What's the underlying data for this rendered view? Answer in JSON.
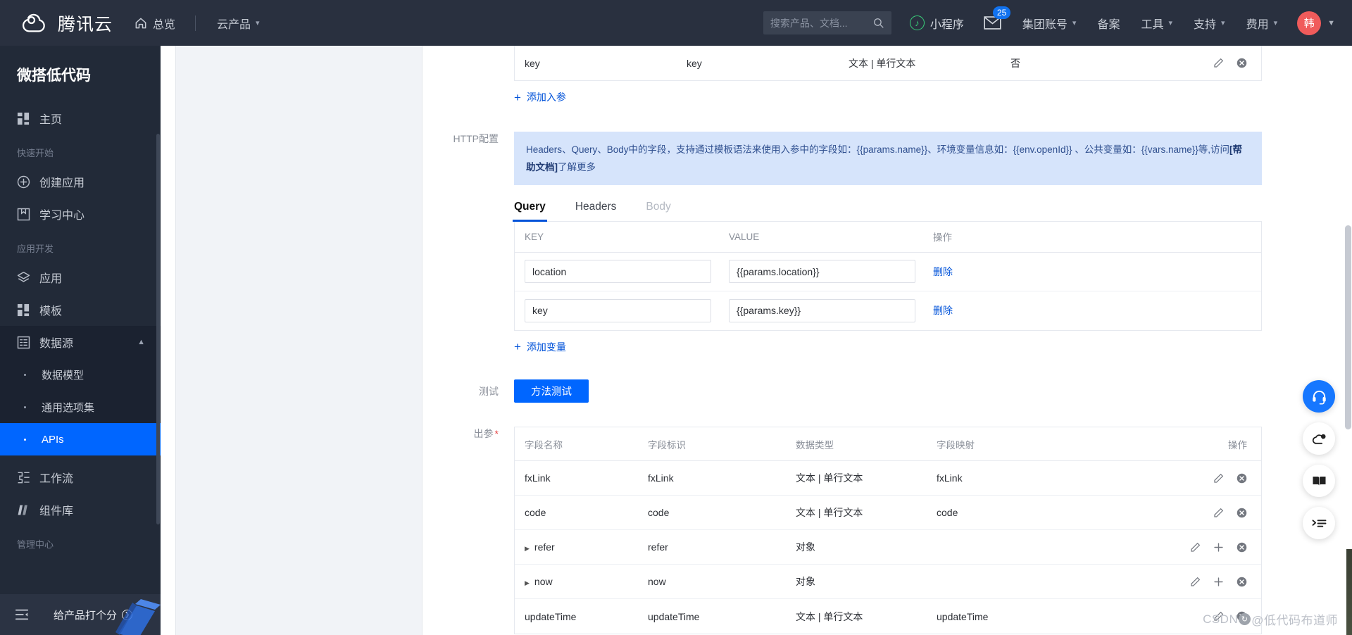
{
  "topnav": {
    "brand": "腾讯云",
    "items": [
      {
        "label": "总览",
        "icon": "home-icon"
      },
      {
        "label": "云产品",
        "icon": "chevron-down-icon"
      }
    ],
    "search": {
      "placeholder": "搜索产品、文档...",
      "value": "",
      "icon": "search-icon"
    },
    "mini_program": "小程序",
    "mail_badge": "25",
    "right_items": [
      {
        "label": "集团账号",
        "caret": true
      },
      {
        "label": "备案",
        "caret": false
      },
      {
        "label": "工具",
        "caret": true
      },
      {
        "label": "支持",
        "caret": true
      },
      {
        "label": "费用",
        "caret": true
      }
    ],
    "avatar_initial": "韩"
  },
  "sidebar": {
    "title": "微搭低代码",
    "home": {
      "label": "主页",
      "icon": "grid-icon"
    },
    "groups": [
      {
        "title": "快速开始",
        "items": [
          {
            "label": "创建应用",
            "icon": "plus-circle-icon"
          },
          {
            "label": "学习中心",
            "icon": "book-icon"
          }
        ]
      },
      {
        "title": "应用开发",
        "items": [
          {
            "label": "应用",
            "icon": "layers-icon"
          },
          {
            "label": "模板",
            "icon": "template-icon"
          },
          {
            "label": "数据源",
            "icon": "database-icon",
            "expanded": true,
            "children": [
              {
                "label": "数据模型",
                "active": false
              },
              {
                "label": "通用选项集",
                "active": false
              },
              {
                "label": "APIs",
                "active": true
              }
            ]
          },
          {
            "label": "工作流",
            "icon": "workflow-icon"
          },
          {
            "label": "组件库",
            "icon": "components-icon"
          }
        ]
      },
      {
        "title": "管理中心",
        "items": []
      }
    ],
    "footer": {
      "rate_label": "给产品打个分",
      "collapse_icon": "collapse-icon"
    }
  },
  "detail": {
    "params_table": {
      "row": {
        "name": "key",
        "id": "key",
        "type": "文本 | 单行文本",
        "required": "否"
      },
      "edit_icon": "pencil-icon",
      "delete_icon": "delete-circle-icon"
    },
    "add_param_link": "添加入参",
    "http_config": {
      "label": "HTTP配置",
      "alert_part1": "Headers、Query、Body中的字段，支持通过模板语法来使用入参中的字段如：{{params.name}}、环境变量信息如：{{env.openId}} 、公共变量如：{{vars.name}}等,访问",
      "alert_link": "[帮助文档]",
      "alert_part2": "了解更多"
    },
    "tabs": [
      {
        "label": "Query",
        "state": "active"
      },
      {
        "label": "Headers",
        "state": "normal"
      },
      {
        "label": "Body",
        "state": "disabled"
      }
    ],
    "query_table": {
      "headers": [
        "KEY",
        "VALUE",
        "操作"
      ],
      "rows": [
        {
          "key": "location",
          "value": "{{params.location}}",
          "action": "删除"
        },
        {
          "key": "key",
          "value": "{{params.key}}",
          "action": "删除"
        }
      ]
    },
    "add_variable_link": "添加变量",
    "test": {
      "label": "测试",
      "button": "方法测试"
    },
    "output": {
      "label": "出参",
      "required_mark": "*",
      "headers": [
        "字段名称",
        "字段标识",
        "数据类型",
        "字段映射",
        "操作"
      ],
      "rows": [
        {
          "name": "fxLink",
          "id": "fxLink",
          "type": "文本 | 单行文本",
          "mapping": "fxLink",
          "expandable": false,
          "addable": false
        },
        {
          "name": "code",
          "id": "code",
          "type": "文本 | 单行文本",
          "mapping": "code",
          "expandable": false,
          "addable": false
        },
        {
          "name": "refer",
          "id": "refer",
          "type": "对象",
          "mapping": "",
          "expandable": true,
          "addable": true
        },
        {
          "name": "now",
          "id": "now",
          "type": "对象",
          "mapping": "",
          "expandable": true,
          "addable": true
        },
        {
          "name": "updateTime",
          "id": "updateTime",
          "type": "文本 | 单行文本",
          "mapping": "updateTime",
          "expandable": false,
          "addable": false
        }
      ]
    }
  },
  "rail": [
    {
      "icon": "headset-icon",
      "primary": true
    },
    {
      "icon": "cloud-bell-icon",
      "primary": false
    },
    {
      "icon": "book-open-icon",
      "primary": false
    },
    {
      "icon": "list-arrow-icon",
      "primary": false
    }
  ],
  "watermark": {
    "prefix": "CSDN",
    "suffix": "@低代码布道师"
  },
  "colors": {
    "accent": "#0066ff",
    "nav_bg": "#29303f",
    "sidebar_bg": "#222a38",
    "alert_bg": "#d6e4fb",
    "link": "#0052d9",
    "avatar": "#f05b5b",
    "badge": "#1172ef"
  }
}
